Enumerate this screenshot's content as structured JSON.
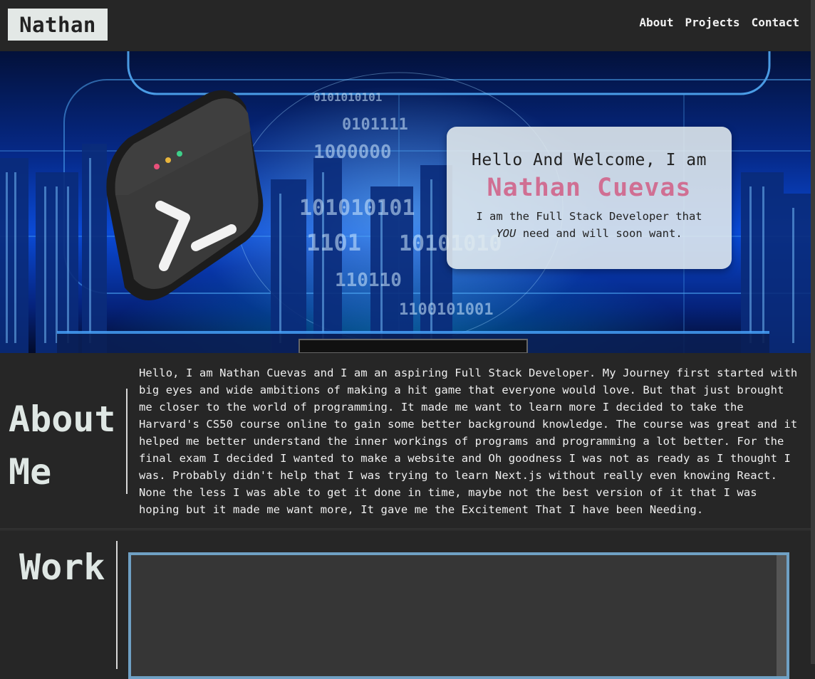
{
  "nav": {
    "logo": "Nathan",
    "links": [
      "About",
      "Projects",
      "Contact"
    ]
  },
  "hero": {
    "greeting": "Hello And Welcome, I am",
    "name": "Nathan Cuevas",
    "tagline_part1": "I am the Full Stack Developer that",
    "tagline_emphasis": "YOU",
    "tagline_part2": "need and will soon want.",
    "background_binary": [
      "0101010101",
      "0101111",
      "1000000",
      "101010101",
      "1101",
      "10101010",
      "110110",
      "1100101001"
    ]
  },
  "about": {
    "title_line1": "About",
    "title_line2": "Me",
    "text": "Hello, I am Nathan Cuevas and I am an aspiring Full Stack Developer. My Journey first started with big eyes and wide ambitions of making a hit game that everyone would love. But that just brought me closer to the world of programming. It made me want to learn more I decided to take the Harvard's CS50 course online to gain some better background knowledge. The course was great and it helped me better understand the inner workings of programs and programming a lot better. For the final exam I decided I wanted to make a website and Oh goodness I was not as ready as I thought I was. Probably didn't help that I was trying to learn Next.js without really even knowing React. None the less I was able to get it done in time, maybe not the best version of it that I was hoping but it made me want more, It gave me the Excitement That I have been Needing."
  },
  "work": {
    "title": "Work"
  },
  "colors": {
    "background": "#262626",
    "accent_name": "#d06f93",
    "frame_border": "#6fa0c4",
    "logo_bg": "#e3e8e6"
  },
  "icons": [
    "terminal-app-icon"
  ]
}
